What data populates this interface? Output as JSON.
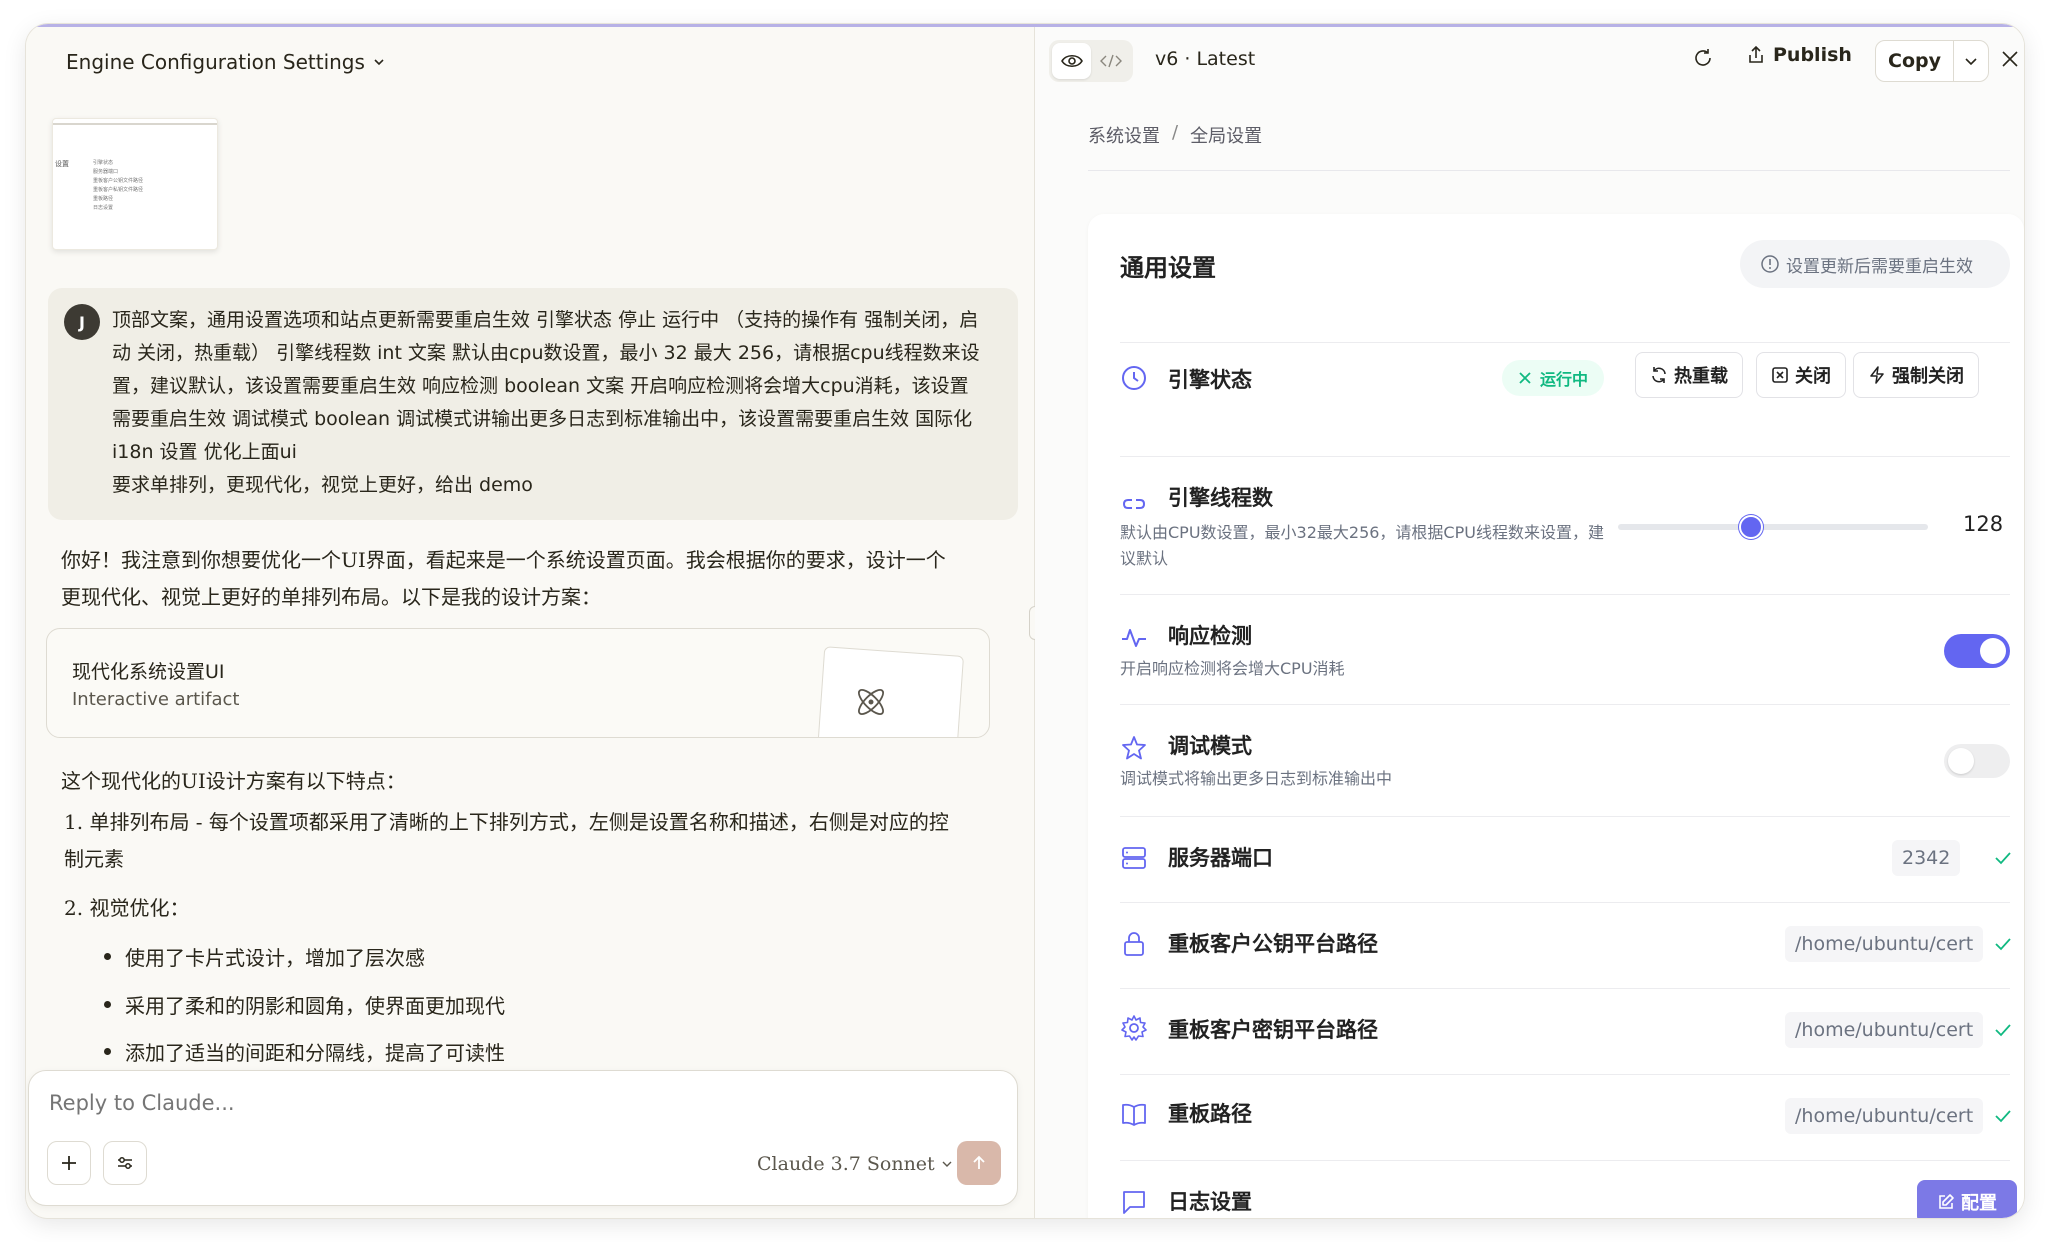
{
  "conversation": {
    "title": "Engine Configuration Settings"
  },
  "thumbnail": {
    "title": "设置",
    "items": [
      "引擎状态",
      "服务器端口",
      "重板客户公钥文件路径",
      "重板客户私钥文件路径",
      "重板路径",
      "日志设置"
    ]
  },
  "user_message": {
    "avatar": "J",
    "text": "顶部文案，通用设置选项和站点更新需要重启生效 引擎状态 停止 运行中 （支持的操作有 强制关闭，启动 关闭，热重载） 引擎线程数 int 文案 默认由cpu数设置，最小 32 最大 256，请根据cpu线程数来设置，建议默认，该设置需要重启生效 响应检测 boolean 文案 开启响应检测将会增大cpu消耗，该设置需要重启生效 调试模式 boolean 调试模式讲输出更多日志到标准输出中，该设置需要重启生效 国际化 i18n 设置 优化上面ui\n要求单排列，更现代化，视觉上更好，给出 demo"
  },
  "assistant": {
    "intro": "你好！我注意到你想要优化一个UI界面，看起来是一个系统设置页面。我会根据你的要求，设计一个更现代化、视觉上更好的单排列布局。以下是我的设计方案：",
    "artifact": {
      "title": "现代化系统设置UI",
      "subtitle": "Interactive artifact"
    },
    "features_heading": "这个现代化的UI设计方案有以下特点：",
    "list": [
      "1. 单排列布局 - 每个设置项都采用了清晰的上下排列方式，左侧是设置名称和描述，右侧是对应的控制元素",
      "2. 视觉优化："
    ],
    "bullets": [
      "使用了卡片式设计，增加了层次感",
      "采用了柔和的阴影和圆角，使界面更加现代",
      "添加了适当的间距和分隔线，提高了可读性"
    ]
  },
  "input": {
    "placeholder": "Reply to Claude...",
    "model": "Claude 3.7 Sonnet"
  },
  "artifact_toolbar": {
    "version": "v6 · Latest",
    "publish": "Publish",
    "copy": "Copy"
  },
  "settings": {
    "breadcrumb": [
      "系统设置",
      "全局设置"
    ],
    "card_title": "通用设置",
    "notice": "设置更新后需要重启生效",
    "engine_status": {
      "label": "引擎状态",
      "status": "运行中",
      "buttons": [
        "热重载",
        "关闭",
        "强制关闭"
      ]
    },
    "threads": {
      "label": "引擎线程数",
      "desc": "默认由CPU数设置，最小32最大256，请根据CPU线程数来设置，建议默认",
      "min": 32,
      "max": 256,
      "value": "128"
    },
    "response_check": {
      "label": "响应检测",
      "desc": "开启响应检测将会增大CPU消耗",
      "enabled": true
    },
    "debug": {
      "label": "调试模式",
      "desc": "调试模式将输出更多日志到标准输出中",
      "enabled": false
    },
    "server_port": {
      "label": "服务器端口",
      "value": "2342"
    },
    "public_key": {
      "label": "重板客户公钥平台路径",
      "value": "/home/ubuntu/cert"
    },
    "private_key": {
      "label": "重板客户密钥平台路径",
      "value": "/home/ubuntu/cert"
    },
    "path": {
      "label": "重板路径",
      "value": "/home/ubuntu/cert"
    },
    "log": {
      "label": "日志设置",
      "button": "配置"
    },
    "colors": {
      "accent": "#6366f1",
      "success": "#10b981",
      "config_button": "#7c79e6"
    }
  }
}
